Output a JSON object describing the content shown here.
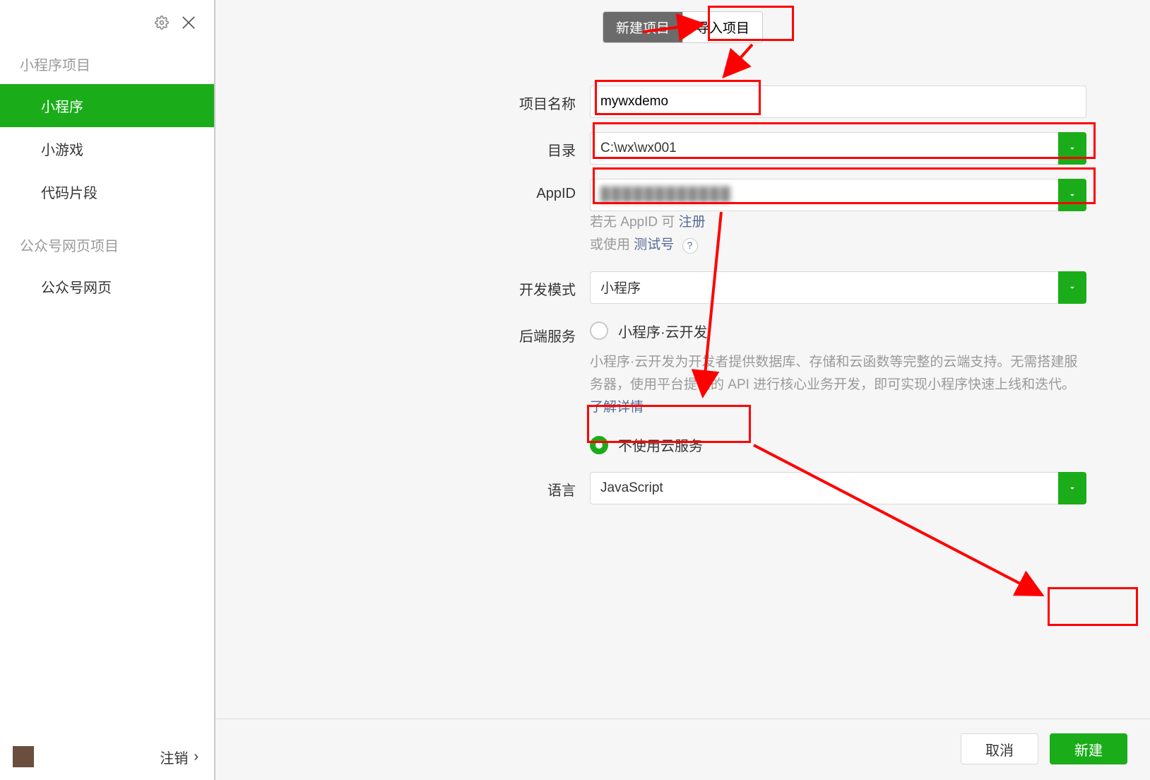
{
  "sidebar": {
    "sections": [
      {
        "header": "小程序项目",
        "items": [
          "小程序",
          "小游戏",
          "代码片段"
        ]
      },
      {
        "header": "公众号网页项目",
        "items": [
          "公众号网页"
        ]
      }
    ],
    "active_item": "小程序",
    "logout_label": "注销"
  },
  "tabs": {
    "new_project": "新建项目",
    "import_project": "导入项目",
    "active": "new_project"
  },
  "form": {
    "project_name": {
      "label": "项目名称",
      "value": "mywxdemo"
    },
    "directory": {
      "label": "目录",
      "value": "C:\\wx\\wx001"
    },
    "appid": {
      "label": "AppID",
      "value": "",
      "hint_prefix": "若无 AppID 可 ",
      "hint_register": "注册",
      "hint_or": "或使用 ",
      "hint_test": "测试号",
      "help": "?"
    },
    "dev_mode": {
      "label": "开发模式",
      "value": "小程序"
    },
    "backend": {
      "label": "后端服务",
      "option_cloud": "小程序·云开发",
      "description": "小程序·云开发为开发者提供数据库、存储和云函数等完整的云端支持。无需搭建服务器，使用平台提供的 API 进行核心业务开发，即可实现小程序快速上线和迭代。 ",
      "learn_more": "了解详情",
      "option_none": "不使用云服务",
      "selected": "none"
    },
    "language": {
      "label": "语言",
      "value": "JavaScript"
    }
  },
  "footer": {
    "cancel": "取消",
    "create": "新建"
  }
}
